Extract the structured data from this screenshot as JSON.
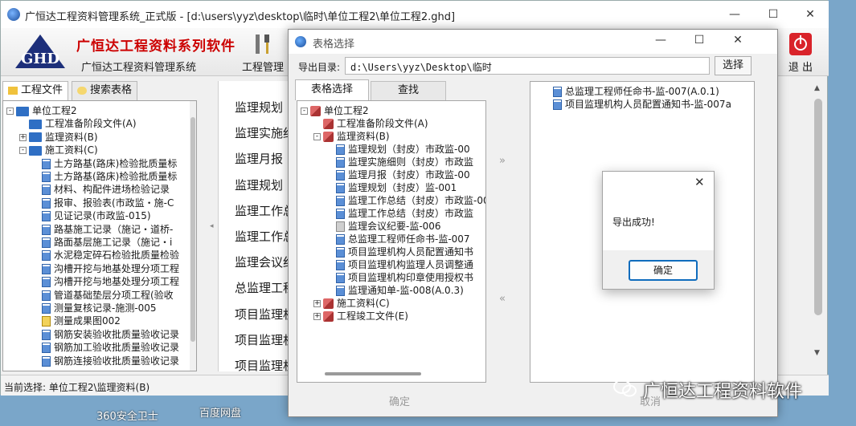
{
  "main_window": {
    "title": "广恒达工程资料管理系统_正式版 - [d:\\users\\yyz\\desktop\\临时\\单位工程2\\单位工程2.ghd]",
    "brand_name": "广恒达工程资料系列软件",
    "brand_sub": "广恒达工程资料管理系统",
    "project_mgmt_label": "工程管理",
    "exit_label": "退 出",
    "tabs": [
      "工程文件",
      "搜索表格"
    ],
    "tree": [
      {
        "label": "单位工程2",
        "level": 0,
        "exp": "-",
        "icon": "folder"
      },
      {
        "label": "工程准备阶段文件(A)",
        "level": 1,
        "exp": "",
        "icon": "folder"
      },
      {
        "label": "监理资料(B)",
        "level": 1,
        "exp": "+",
        "icon": "folder"
      },
      {
        "label": "施工资料(C)",
        "level": 1,
        "exp": "-",
        "icon": "folder"
      },
      {
        "label": "土方路基(路床)检验批质量标",
        "level": 2,
        "exp": "",
        "icon": "doc"
      },
      {
        "label": "土方路基(路床)检验批质量标",
        "level": 2,
        "exp": "",
        "icon": "doc"
      },
      {
        "label": "材料、构配件进场检验记录",
        "level": 2,
        "exp": "",
        "icon": "doc"
      },
      {
        "label": "报审、报验表(市政监・施-C",
        "level": 2,
        "exp": "",
        "icon": "doc"
      },
      {
        "label": "见证记录(市政监-015)",
        "level": 2,
        "exp": "",
        "icon": "doc"
      },
      {
        "label": "路基施工记录（施记・道桥-",
        "level": 2,
        "exp": "",
        "icon": "doc"
      },
      {
        "label": "路面基层施工记录（施记・i",
        "level": 2,
        "exp": "",
        "icon": "doc"
      },
      {
        "label": "水泥稳定碎石检验批质量检验",
        "level": 2,
        "exp": "",
        "icon": "doc"
      },
      {
        "label": "沟槽开挖与地基处理分项工程",
        "level": 2,
        "exp": "",
        "icon": "doc"
      },
      {
        "label": "沟槽开挖与地基处理分项工程",
        "level": 2,
        "exp": "",
        "icon": "doc"
      },
      {
        "label": "管道基础垫层分项工程(验收",
        "level": 2,
        "exp": "",
        "icon": "doc"
      },
      {
        "label": "测量复核记录-施测-005",
        "level": 2,
        "exp": "",
        "icon": "doc"
      },
      {
        "label": "测量成果图002",
        "level": 2,
        "exp": "",
        "icon": "yellow"
      },
      {
        "label": "钢筋安装验收批质量验收记录",
        "level": 2,
        "exp": "",
        "icon": "doc"
      },
      {
        "label": "钢筋加工验收批质量验收记录",
        "level": 2,
        "exp": "",
        "icon": "doc"
      },
      {
        "label": "钢筋连接验收批质量验收记录",
        "level": 2,
        "exp": "",
        "icon": "doc"
      }
    ],
    "right_list": [
      "监理规划",
      "监理实施细",
      "监理月报",
      "监理规划",
      "监理工作总",
      "监理工作总",
      "监理会议纪",
      "总监理工程",
      "项目监理机",
      "项目监理机",
      "项目监理机"
    ],
    "status": "当前选择: 单位工程2\\监理资料(B)"
  },
  "dialog": {
    "title": "表格选择",
    "export_label": "导出目录:",
    "export_path": "d:\\Users\\yyz\\Desktop\\临时",
    "select_button": "选择",
    "tab_tree": "表格选择",
    "tab_find": "查找",
    "tree": [
      {
        "label": "单位工程2",
        "level": 0,
        "exp": "-",
        "icon": "red"
      },
      {
        "label": "工程准备阶段文件(A)",
        "level": 1,
        "exp": "",
        "icon": "red"
      },
      {
        "label": "监理资料(B)",
        "level": 1,
        "exp": "-",
        "icon": "red"
      },
      {
        "label": "监理规划（封皮）市政监-00",
        "level": 2,
        "exp": "",
        "icon": "doc"
      },
      {
        "label": "监理实施细则（封皮）市政监",
        "level": 2,
        "exp": "",
        "icon": "doc"
      },
      {
        "label": "监理月报（封皮）市政监-00",
        "level": 2,
        "exp": "",
        "icon": "doc"
      },
      {
        "label": "监理规划（封皮）监-001",
        "level": 2,
        "exp": "",
        "icon": "doc"
      },
      {
        "label": "监理工作总结（封皮）市政监-00",
        "level": 2,
        "exp": "",
        "icon": "doc"
      },
      {
        "label": "监理工作总结（封皮）市政监",
        "level": 2,
        "exp": "",
        "icon": "doc"
      },
      {
        "label": "监理会议纪要-监-006",
        "level": 2,
        "exp": "",
        "icon": "gray"
      },
      {
        "label": "总监理工程师任命书-监-007",
        "level": 2,
        "exp": "",
        "icon": "doc"
      },
      {
        "label": "项目监理机构人员配置通知书",
        "level": 2,
        "exp": "",
        "icon": "doc"
      },
      {
        "label": "项目监理机构监理人员调整通",
        "level": 2,
        "exp": "",
        "icon": "doc"
      },
      {
        "label": "项目监理机构印章使用授权书",
        "level": 2,
        "exp": "",
        "icon": "doc"
      },
      {
        "label": "监理通知单-监-008(A.0.3)",
        "level": 2,
        "exp": "",
        "icon": "doc"
      },
      {
        "label": "施工资料(C)",
        "level": 1,
        "exp": "+",
        "icon": "red"
      },
      {
        "label": "工程竣工文件(E)",
        "level": 1,
        "exp": "+",
        "icon": "red"
      }
    ],
    "selected": [
      "总监理工程师任命书-监-007(A.0.1)",
      "项目监理机构人员配置通知书-监-007a"
    ],
    "ok_label": "确定",
    "cancel_label": "取消",
    "arrow_right": "»",
    "arrow_left": "«"
  },
  "msgbox": {
    "text": "导出成功!",
    "ok_label": "确定",
    "close_glyph": "✕"
  },
  "desktop": {
    "label_360": "360安全卫士",
    "label_baidu": "百度网盘",
    "watermark": "广恒达工程资料软件"
  }
}
